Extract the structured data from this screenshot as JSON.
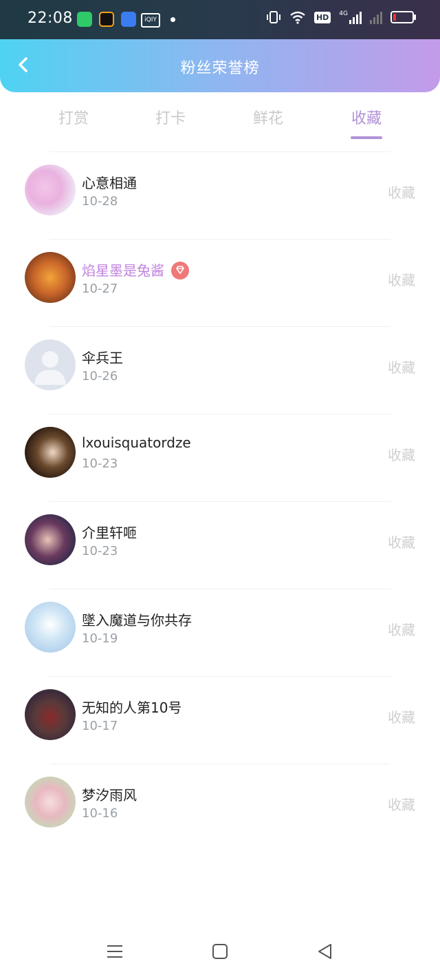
{
  "status_bar": {
    "time": "22:08",
    "icons": [
      "app-green-icon",
      "app-orange-icon",
      "app-blue-icon",
      "iqiyi-icon",
      "vibrate-icon",
      "wifi-icon",
      "hd-icon",
      "4g-signal-icon",
      "no-signal-icon",
      "battery-low-icon"
    ],
    "hd_label": "HD",
    "signal_label": "4G",
    "iqiyi_label": "iQIY"
  },
  "header": {
    "title": "粉丝荣誉榜",
    "gradient": [
      "#4fd3f2",
      "#c39be9"
    ]
  },
  "tabs": [
    {
      "label": "打赏",
      "active": false
    },
    {
      "label": "打卡",
      "active": false
    },
    {
      "label": "鲜花",
      "active": false
    },
    {
      "label": "收藏",
      "active": true
    }
  ],
  "accent_color": "#b292d8",
  "fans": [
    {
      "name": "心意相通",
      "date": "10-28",
      "action": "收藏",
      "vip": false
    },
    {
      "name": "焰星墨是兔酱",
      "date": "10-27",
      "action": "收藏",
      "vip": true
    },
    {
      "name": "伞兵王",
      "date": "10-26",
      "action": "收藏",
      "vip": false
    },
    {
      "name": "lxouisquatordze",
      "date": "10-23",
      "action": "收藏",
      "vip": false
    },
    {
      "name": "介里轩咂",
      "date": "10-23",
      "action": "收藏",
      "vip": false
    },
    {
      "name": "墜入魔道与你共存",
      "date": "10-19",
      "action": "收藏",
      "vip": false
    },
    {
      "name": "无知的人第10号",
      "date": "10-17",
      "action": "收藏",
      "vip": false
    },
    {
      "name": "梦汐雨风",
      "date": "10-16",
      "action": "收藏",
      "vip": false
    }
  ],
  "nav_bar": {
    "buttons": [
      "menu-icon",
      "home-icon",
      "back-triangle-icon"
    ]
  }
}
